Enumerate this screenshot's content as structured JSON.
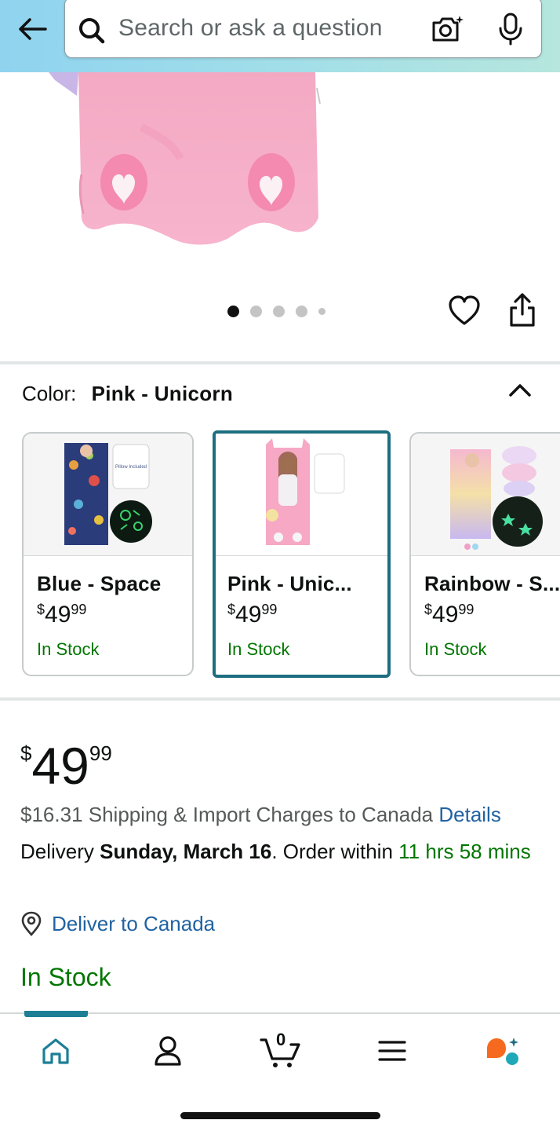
{
  "header": {
    "search_placeholder": "Search or ask a question",
    "icons": [
      "back-arrow-icon",
      "search-icon",
      "camera-lens-icon",
      "microphone-icon"
    ]
  },
  "gallery": {
    "total_images": 5,
    "current_index": 1
  },
  "color": {
    "label": "Color:",
    "value": "Pink - Unicorn"
  },
  "swatches": [
    {
      "title": "Blue - Space",
      "price_symbol": "$",
      "price_whole": "49",
      "price_cents": "99",
      "stock": "In Stock",
      "pillow_text": "Pillow Included",
      "selected": false
    },
    {
      "title": "Pink - Unic...",
      "price_symbol": "$",
      "price_whole": "49",
      "price_cents": "99",
      "stock": "In Stock",
      "selected": true
    },
    {
      "title": "Rainbow - S...",
      "price_symbol": "$",
      "price_whole": "49",
      "price_cents": "99",
      "stock": "In Stock",
      "selected": false
    }
  ],
  "price": {
    "symbol": "$",
    "whole": "49",
    "cents": "99"
  },
  "shipping": {
    "text": "$16.31 Shipping & Import Charges to Canada",
    "details_link": "Details"
  },
  "delivery": {
    "prefix": "Delivery",
    "date": "Sunday, March 16",
    "middle": ". Order within",
    "countdown": "11 hrs 58 mins"
  },
  "deliver_to": "Deliver to Canada",
  "in_stock": "In Stock",
  "bottom_nav": {
    "cart_count": "0",
    "items": [
      "home-icon",
      "account-icon",
      "cart-icon",
      "menu-icon",
      "rufus-assistant-icon"
    ]
  },
  "colors": {
    "accent_teal": "#1d6e80",
    "stock_green": "#007600",
    "link_blue": "#2162a1",
    "header_gradient_start": "#8fd3ef",
    "header_gradient_end": "#b6e6de"
  }
}
